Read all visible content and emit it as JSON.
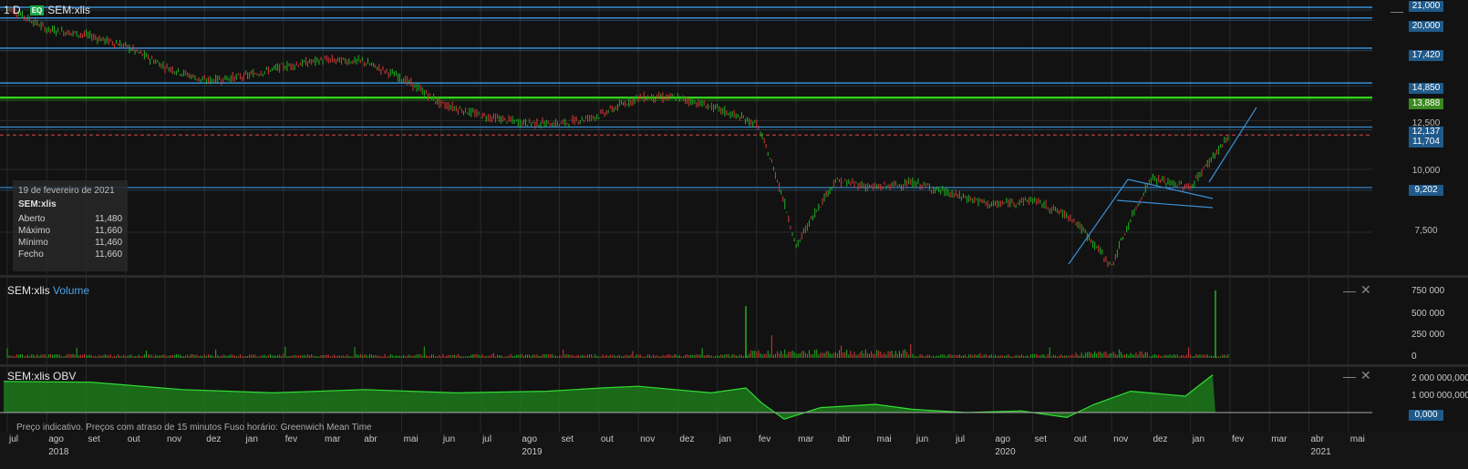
{
  "header": {
    "timeframe": "1 D",
    "badge": "EQ",
    "symbol": "SEM:xlis"
  },
  "infobox": {
    "date": "19 de fevereiro de 2021",
    "symbol": "SEM:xlis",
    "rows": [
      {
        "label": "Aberto",
        "value": "11,480"
      },
      {
        "label": "Máximo",
        "value": "11,660"
      },
      {
        "label": "Mínimo",
        "value": "11,460"
      },
      {
        "label": "Fecho",
        "value": "11,660"
      }
    ]
  },
  "price_axis": {
    "tags": [
      {
        "text": "21,000",
        "style": "blue"
      },
      {
        "text": "20,000",
        "style": "blue"
      },
      {
        "text": "17,420",
        "style": "blue"
      },
      {
        "text": "14,850",
        "style": "blue"
      },
      {
        "text": "13,888",
        "style": "green"
      },
      {
        "text": "12,500",
        "style": "plain"
      },
      {
        "text": "12,137",
        "style": "blue"
      },
      {
        "text": "11,704",
        "style": "blue"
      },
      {
        "text": "10,000",
        "style": "plain"
      },
      {
        "text": "9,202",
        "style": "blue"
      },
      {
        "text": "7,500",
        "style": "plain"
      }
    ]
  },
  "volume_pane": {
    "symbol": "SEM:xlis",
    "indicator": "Volume",
    "ticks": [
      "750 000",
      "500 000",
      "250 000",
      "0"
    ]
  },
  "obv_pane": {
    "symbol": "SEM:xlis",
    "indicator": "OBV",
    "ticks": [
      "2 000 000,000",
      "1 000 000,000"
    ],
    "zero_tag": "0,000"
  },
  "footer_note": "Preço indicativo. Preços com atraso de 15 minutos   Fuso horário: Greenwich Mean Time",
  "time_axis": {
    "months": [
      "jul",
      "ago",
      "set",
      "out",
      "nov",
      "dez",
      "jan",
      "fev",
      "mar",
      "abr",
      "mai",
      "jun",
      "jul",
      "ago",
      "set",
      "out",
      "nov",
      "dez",
      "jan",
      "fev",
      "mar",
      "abr",
      "mai",
      "jun",
      "jul",
      "ago",
      "set",
      "out",
      "nov",
      "dez",
      "jan",
      "fev",
      "mar",
      "abr",
      "mai"
    ],
    "years": [
      "2018",
      "2019",
      "2020",
      "2021"
    ]
  },
  "chart_data": {
    "type": "line",
    "series": [
      {
        "name": "SEM:xlis",
        "x": [
          "2018-07",
          "2018-08",
          "2018-09",
          "2018-10",
          "2018-11",
          "2018-12",
          "2019-01",
          "2019-02",
          "2019-03",
          "2019-04",
          "2019-05",
          "2019-06",
          "2019-07",
          "2019-08",
          "2019-09",
          "2019-10",
          "2019-11",
          "2019-12",
          "2020-01",
          "2020-02",
          "2020-03",
          "2020-04",
          "2020-05",
          "2020-06",
          "2020-07",
          "2020-08",
          "2020-09",
          "2020-10",
          "2020-11",
          "2020-12",
          "2021-01",
          "2021-02"
        ],
        "values": [
          21.0,
          19.0,
          18.5,
          17.6,
          16.0,
          15.0,
          15.3,
          16.0,
          16.5,
          16.4,
          15.2,
          13.5,
          12.8,
          12.4,
          12.3,
          12.8,
          13.9,
          13.9,
          13.2,
          12.3,
          7.0,
          9.5,
          9.2,
          9.4,
          8.9,
          8.5,
          8.7,
          8.0,
          6.4,
          9.6,
          9.2,
          11.66
        ]
      }
    ],
    "volume_peaks": [
      {
        "x": "2020-03",
        "value": 600000
      },
      {
        "x": "2021-02",
        "value": 780000
      }
    ],
    "obv_ylim": [
      -200000000,
      2300000000
    ],
    "volume_ylim": [
      0,
      800000
    ]
  },
  "colors": {
    "up": "#1fb31f",
    "down": "#d43a3a",
    "line": "#3a8fd6",
    "green_level": "#33cc1a"
  }
}
